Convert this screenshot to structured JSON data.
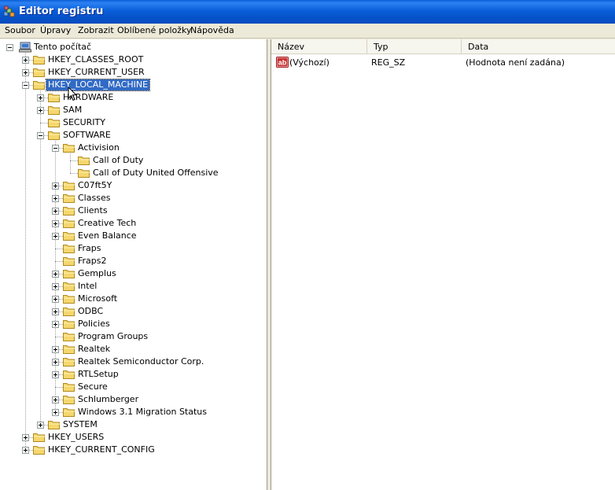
{
  "window": {
    "title": "Editor registru"
  },
  "menu": [
    "Soubor",
    "Úpravy",
    "Zobrazit",
    "Oblíbené položky",
    "Nápověda"
  ],
  "tree": [
    {
      "label": "Tento počítač",
      "level": 0,
      "expander": "minus",
      "icon": "computer-icon"
    },
    {
      "label": "HKEY_CLASSES_ROOT",
      "level": 1,
      "expander": "plus"
    },
    {
      "label": "HKEY_CURRENT_USER",
      "level": 1,
      "expander": "plus"
    },
    {
      "label": "HKEY_LOCAL_MACHINE",
      "level": 1,
      "expander": "minus",
      "open": true,
      "selected": true
    },
    {
      "label": "HARDWARE",
      "level": 2,
      "expander": "plus"
    },
    {
      "label": "SAM",
      "level": 2,
      "expander": "plus"
    },
    {
      "label": "SECURITY",
      "level": 2,
      "expander": "none"
    },
    {
      "label": "SOFTWARE",
      "level": 2,
      "expander": "minus",
      "open": true
    },
    {
      "label": "Activision",
      "level": 3,
      "expander": "minus",
      "open": true
    },
    {
      "label": "Call of Duty",
      "level": 4,
      "expander": "none"
    },
    {
      "label": "Call of Duty United Offensive",
      "level": 4,
      "expander": "none"
    },
    {
      "label": "C07ft5Y",
      "level": 3,
      "expander": "plus"
    },
    {
      "label": "Classes",
      "level": 3,
      "expander": "plus"
    },
    {
      "label": "Clients",
      "level": 3,
      "expander": "plus"
    },
    {
      "label": "Creative Tech",
      "level": 3,
      "expander": "plus"
    },
    {
      "label": "Even Balance",
      "level": 3,
      "expander": "plus"
    },
    {
      "label": "Fraps",
      "level": 3,
      "expander": "none"
    },
    {
      "label": "Fraps2",
      "level": 3,
      "expander": "none"
    },
    {
      "label": "Gemplus",
      "level": 3,
      "expander": "plus"
    },
    {
      "label": "Intel",
      "level": 3,
      "expander": "plus"
    },
    {
      "label": "Microsoft",
      "level": 3,
      "expander": "plus"
    },
    {
      "label": "ODBC",
      "level": 3,
      "expander": "plus"
    },
    {
      "label": "Policies",
      "level": 3,
      "expander": "plus"
    },
    {
      "label": "Program Groups",
      "level": 3,
      "expander": "none"
    },
    {
      "label": "Realtek",
      "level": 3,
      "expander": "plus"
    },
    {
      "label": "Realtek Semiconductor Corp.",
      "level": 3,
      "expander": "plus"
    },
    {
      "label": "RTLSetup",
      "level": 3,
      "expander": "plus"
    },
    {
      "label": "Secure",
      "level": 3,
      "expander": "none"
    },
    {
      "label": "Schlumberger",
      "level": 3,
      "expander": "plus"
    },
    {
      "label": "Windows 3.1 Migration Status",
      "level": 3,
      "expander": "plus"
    },
    {
      "label": "SYSTEM",
      "level": 2,
      "expander": "plus"
    },
    {
      "label": "HKEY_USERS",
      "level": 1,
      "expander": "plus"
    },
    {
      "label": "HKEY_CURRENT_CONFIG",
      "level": 1,
      "expander": "plus"
    }
  ],
  "list": {
    "columns": [
      "Název",
      "Typ",
      "Data"
    ],
    "rows": [
      {
        "name": "(Výchozí)",
        "type": "REG_SZ",
        "data": "(Hodnota není zadána)",
        "icon": "string-value-icon"
      }
    ]
  },
  "colors": {
    "title_bar": "#0A5ED9",
    "selection": "#316AC5",
    "folder": "#F5D76E"
  }
}
